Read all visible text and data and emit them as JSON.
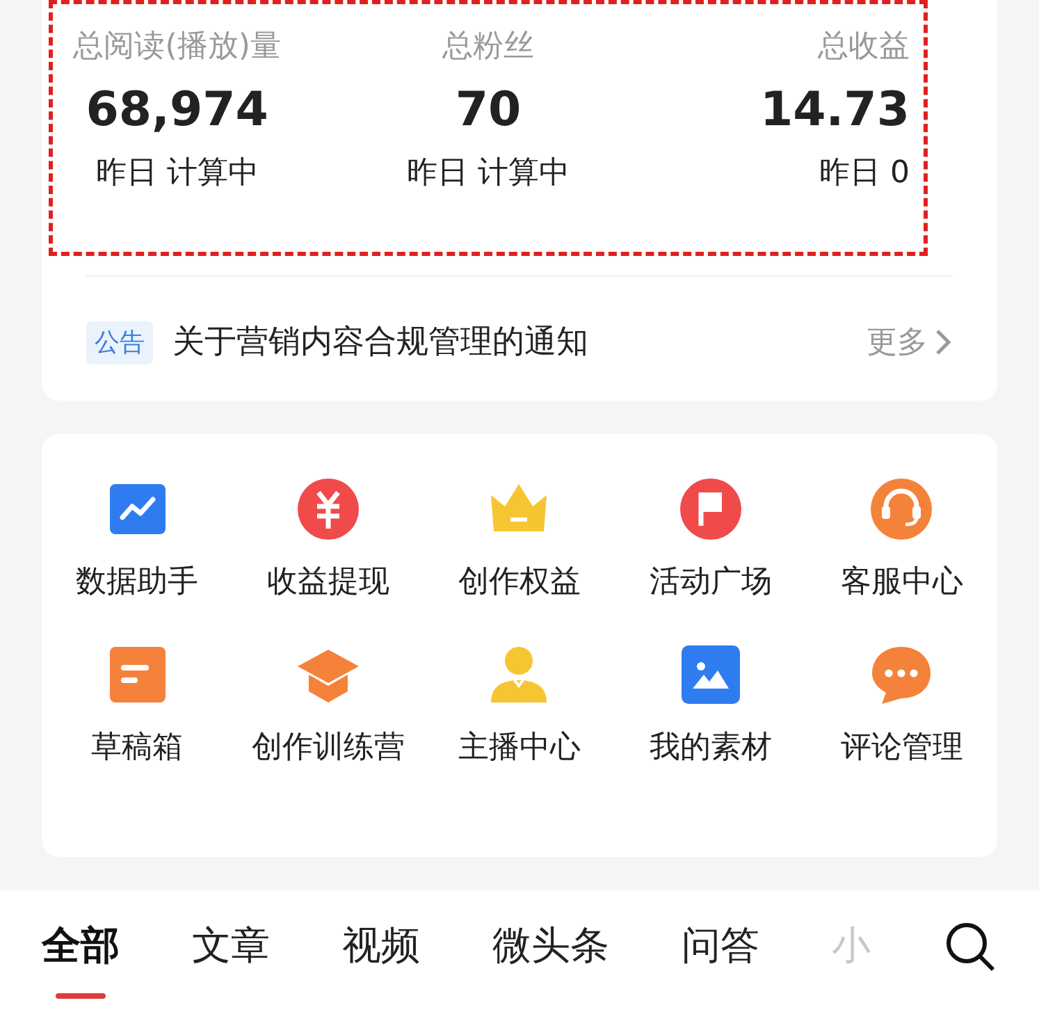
{
  "stats": [
    {
      "label": "总阅读(播放)量",
      "value": "68,974",
      "yesterday": "昨日 计算中"
    },
    {
      "label": "总粉丝",
      "value": "70",
      "yesterday": "昨日 计算中"
    },
    {
      "label": "总收益",
      "value": "14.73",
      "yesterday": "昨日 0"
    }
  ],
  "notice": {
    "tag": "公告",
    "text": "关于营销内容合规管理的通知",
    "more": "更多"
  },
  "tools": [
    {
      "kind": "chart",
      "label": "数据助手",
      "color": "#2f7cf0"
    },
    {
      "kind": "yen",
      "label": "收益提现",
      "color": "#f04a4a"
    },
    {
      "kind": "crown",
      "label": "创作权益",
      "color": "#f7c531"
    },
    {
      "kind": "flag",
      "label": "活动广场",
      "color": "#f04a4a"
    },
    {
      "kind": "headset",
      "label": "客服中心",
      "color": "#f5823a"
    },
    {
      "kind": "draft",
      "label": "草稿箱",
      "color": "#f5823a"
    },
    {
      "kind": "cap",
      "label": "创作训练营",
      "color": "#f5823a"
    },
    {
      "kind": "person",
      "label": "主播中心",
      "color": "#f7c531"
    },
    {
      "kind": "image",
      "label": "我的素材",
      "color": "#2f7cf0"
    },
    {
      "kind": "chat",
      "label": "评论管理",
      "color": "#f5823a"
    }
  ],
  "tabs": [
    {
      "label": "全部",
      "selected": true
    },
    {
      "label": "文章",
      "selected": false
    },
    {
      "label": "视频",
      "selected": false
    },
    {
      "label": "微头条",
      "selected": false
    },
    {
      "label": "问答",
      "selected": false
    },
    {
      "label": "小",
      "selected": false,
      "faded": true
    }
  ]
}
